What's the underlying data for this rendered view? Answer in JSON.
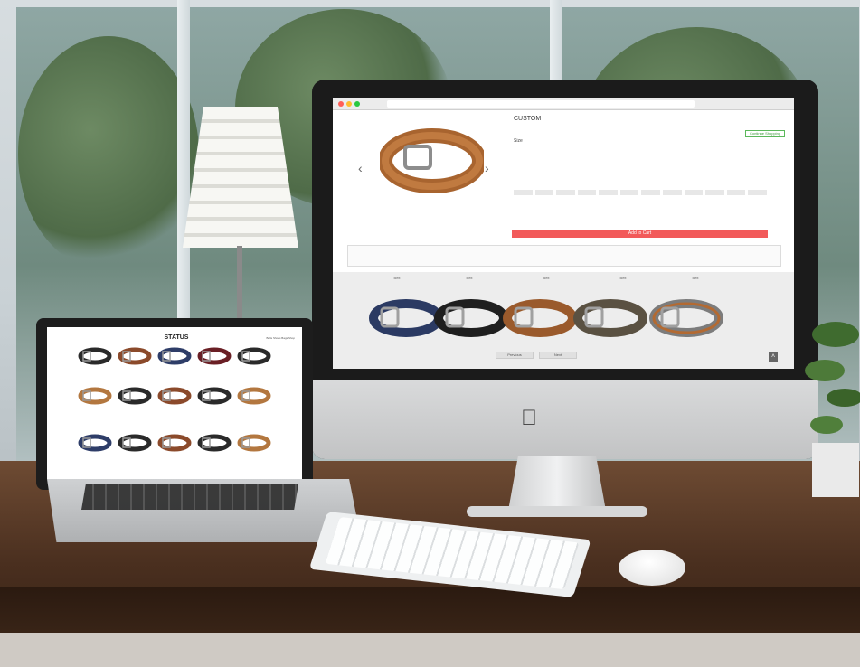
{
  "scene": {
    "description_tags": [
      "desk",
      "imac",
      "laptop",
      "keyboard",
      "mouse",
      "lamp",
      "plant",
      "window"
    ]
  },
  "imac_site": {
    "product_name": "CUSTOM",
    "continue_label": "Continue Shopping",
    "size_label": "Size",
    "add_to_cart": "Add to Cart",
    "pager_prev": "Previous",
    "pager_next": "Next",
    "gallery_labels": [
      "Belt",
      "Belt",
      "Belt",
      "Belt",
      "Belt"
    ],
    "colors": {
      "belt_navy": "#2b3a63",
      "belt_black": "#1f1f1f",
      "belt_tan": "#9a5a2c",
      "belt_olive": "#5a5142",
      "belt_gray": "#7c7c7c",
      "accent_green": "#5bb85b",
      "cta_red": "#f25a5a"
    },
    "icons": [
      "chevron-left-icon",
      "chevron-right-icon",
      "scroll-top-icon"
    ]
  },
  "laptop_site": {
    "brand": "STATUS",
    "nav": "Belts Shoes Bags Shop",
    "colors": {
      "leather_brown": "#8b4a2b",
      "leather_black": "#2a2a2a",
      "leather_navy": "#2e3d68",
      "leather_burgundy": "#6a1f25",
      "leather_tan": "#b3773f"
    }
  }
}
